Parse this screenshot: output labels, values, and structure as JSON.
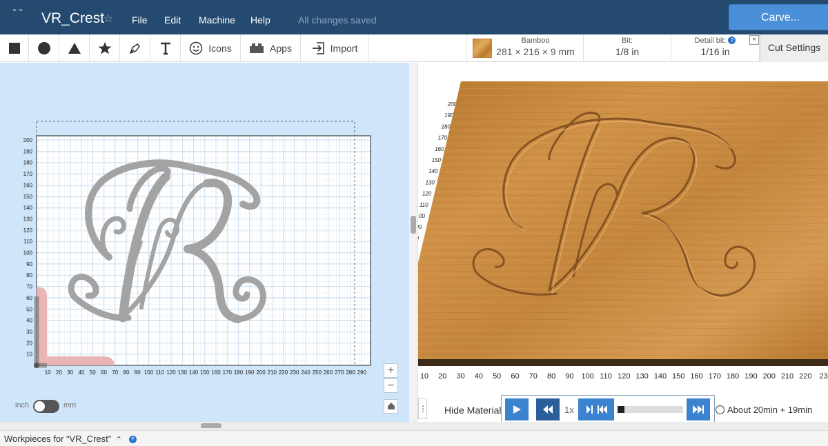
{
  "header": {
    "title": "VR_Crest",
    "menus": [
      "File",
      "Edit",
      "Machine",
      "Help"
    ],
    "status": "All changes saved",
    "carve_label": "Carve..."
  },
  "toolbar": {
    "shape_tools": [
      "square-icon",
      "circle-icon",
      "triangle-icon",
      "star-icon",
      "pen-icon",
      "text-icon"
    ],
    "icons_label": "Icons",
    "apps_label": "Apps",
    "import_label": "Import"
  },
  "material": {
    "name": "Bamboo",
    "dimensions": "281 × 216 × 9 mm",
    "bit_label": "Bit:",
    "bit_value": "1/8 in",
    "detail_label": "Detail bit:",
    "detail_value": "1/16 in",
    "help": "?",
    "close": "×",
    "cut_settings": "Cut Settings"
  },
  "canvas": {
    "y_ticks": [
      "200",
      "190",
      "180",
      "170",
      "160",
      "150",
      "140",
      "130",
      "120",
      "110",
      "100",
      "90",
      "80",
      "70",
      "60",
      "50",
      "40",
      "30",
      "20",
      "10"
    ],
    "x_ticks": [
      "10",
      "20",
      "30",
      "40",
      "50",
      "60",
      "70",
      "80",
      "90",
      "100",
      "110",
      "120",
      "130",
      "140",
      "150",
      "160",
      "170",
      "180",
      "190",
      "200",
      "210",
      "220",
      "230",
      "240",
      "250",
      "260",
      "270",
      "280",
      "290"
    ],
    "zoom_in": "+",
    "zoom_out": "−",
    "unit_inch": "inch",
    "unit_mm": "mm"
  },
  "preview": {
    "y_ticks": [
      "200",
      "190",
      "180",
      "170",
      "160",
      "150",
      "140",
      "130",
      "120",
      "110",
      "100",
      "90",
      "80"
    ],
    "x_ticks": [
      "10",
      "20",
      "30",
      "40",
      "50",
      "60",
      "70",
      "80",
      "90",
      "100",
      "110",
      "120",
      "130",
      "140",
      "150",
      "160",
      "170",
      "180",
      "190",
      "200",
      "210",
      "220",
      "23"
    ],
    "hide_material": "Hide Material",
    "speed": "1x",
    "progress": 0.1,
    "time": "About 20min + 19min"
  },
  "workpieces": {
    "label": "Workpieces for “VR_Crest”",
    "toggle": "⌃",
    "help": "?"
  },
  "colors": {
    "header_bg": "#244a70",
    "accent": "#4a90d9",
    "canvas_bg": "#cfe5f9",
    "design_gray": "#a3a3a3",
    "wood": "#c98a3a"
  }
}
